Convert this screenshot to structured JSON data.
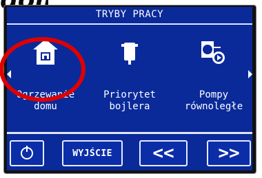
{
  "page_fragment_text": "domu",
  "screen": {
    "header_title": "TRYBY PRACY",
    "modes": [
      {
        "line1": "Ogrzewanie",
        "line2": "domu",
        "icon": "house-icon"
      },
      {
        "line1": "Priorytet",
        "line2": "bojlera",
        "icon": "boiler-icon"
      },
      {
        "line1": "Pompy",
        "line2": "równoległe",
        "icon": "pumps-icon"
      }
    ],
    "buttons": {
      "power_icon": "power-icon",
      "exit_label": "WYJŚCIE",
      "prev_label": "<<",
      "next_label": ">>"
    }
  },
  "colors": {
    "screen_bg": "#0a2a99",
    "frame": "#111111",
    "highlight": "#e00000",
    "text": "#ffffff"
  }
}
